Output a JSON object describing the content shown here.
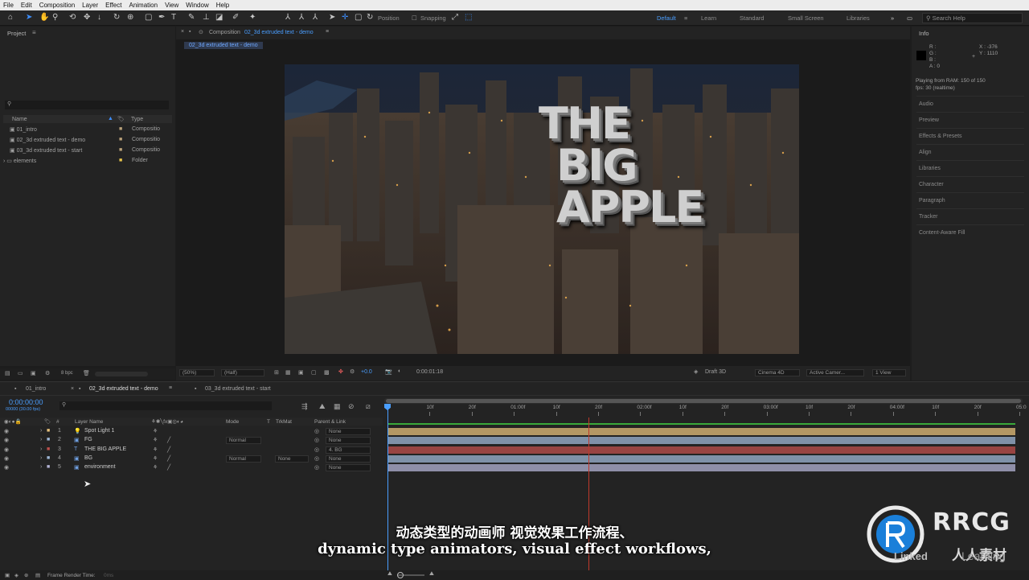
{
  "menu": [
    "File",
    "Edit",
    "Composition",
    "Layer",
    "Effect",
    "Animation",
    "View",
    "Window",
    "Help"
  ],
  "toolbar": {
    "position_label": "Position",
    "snapping_label": "Snapping"
  },
  "workspaces": [
    "Default",
    "Learn",
    "Standard",
    "Small Screen",
    "Libraries"
  ],
  "search_placeholder": "Search Help",
  "project": {
    "title": "Project",
    "col_name": "Name",
    "col_type": "Type",
    "items": [
      {
        "name": "01_intro",
        "type": "Compositio"
      },
      {
        "name": "02_3d extruded text - demo",
        "type": "Compositio"
      },
      {
        "name": "03_3d extruded text - start",
        "type": "Compositio"
      },
      {
        "name": "elements",
        "type": "Folder"
      }
    ],
    "bpc": "8 bpc"
  },
  "composition": {
    "title_prefix": "Composition",
    "title_name": "02_3d extruded text - demo",
    "tab": "02_3d extruded text - demo",
    "viewer_text": [
      "THE",
      "BIG",
      "APPLE"
    ],
    "zoom": "(50%)",
    "resolution": "(Half)",
    "exposure": "+0.0",
    "timecode": "0:00:01:18",
    "renderer": "Draft 3D",
    "renderer_name": "Cinema 4D",
    "camera": "Active Camer...",
    "views": "1 View"
  },
  "info": {
    "title": "Info",
    "r": "R :",
    "g": "G :",
    "b": "B :",
    "a": "A : 0",
    "x": "X : -376",
    "y": "Y : 1110",
    "status1": "Playing from RAM: 150 of 150",
    "status2": "fps: 30 (realtime)",
    "sections": [
      "Audio",
      "Preview",
      "Effects & Presets",
      "Align",
      "Libraries",
      "Character",
      "Paragraph",
      "Tracker",
      "Content-Aware Fill"
    ]
  },
  "timeline": {
    "tabs": [
      "01_intro",
      "02_3d extruded text - demo",
      "03_3d extruded text - start"
    ],
    "timecode": "0:00:00:00",
    "frames": "00000 (30.00 fps)",
    "headers": {
      "layer_name": "Layer Name",
      "mode": "Mode",
      "t": "T",
      "trkmat": "TrkMat",
      "parent": "Parent & Link"
    },
    "layers": [
      {
        "num": "1",
        "name": "Spot Light 1",
        "mode": "",
        "trkmat": "",
        "parent": "None",
        "color": "#e5c07b"
      },
      {
        "num": "2",
        "name": "FG",
        "mode": "Normal",
        "trkmat": "",
        "parent": "None",
        "color": "#9fb7d6"
      },
      {
        "num": "3",
        "name": "THE BIG APPLE",
        "mode": "",
        "trkmat": "",
        "parent": "4. BG",
        "color": "#c0504d"
      },
      {
        "num": "4",
        "name": "BG",
        "mode": "Normal",
        "trkmat": "None",
        "parent": "None",
        "color": "#9fb7d6"
      },
      {
        "num": "5",
        "name": "environment",
        "mode": "",
        "trkmat": "",
        "parent": "None",
        "color": "#b4b4d6"
      }
    ],
    "ruler": [
      "0f",
      "10f",
      "20f",
      "01:00f",
      "10f",
      "20f",
      "02:00f",
      "10f",
      "20f",
      "03:00f",
      "10f",
      "20f",
      "04:00f",
      "10f",
      "20f",
      "05:0"
    ],
    "render_time_label": "Frame Render Time:",
    "render_time": "0ms",
    "playhead_seconds": 0,
    "cti_seconds": 1.6
  },
  "subtitle": {
    "zh": "动态类型的动画师 视觉效果工作流程、",
    "en": "dynamic type animators, visual effect workflows,"
  },
  "watermark": {
    "brand": "RRCG",
    "cn": "人人素材",
    "li": "Linked",
    "learning": "Learning"
  }
}
